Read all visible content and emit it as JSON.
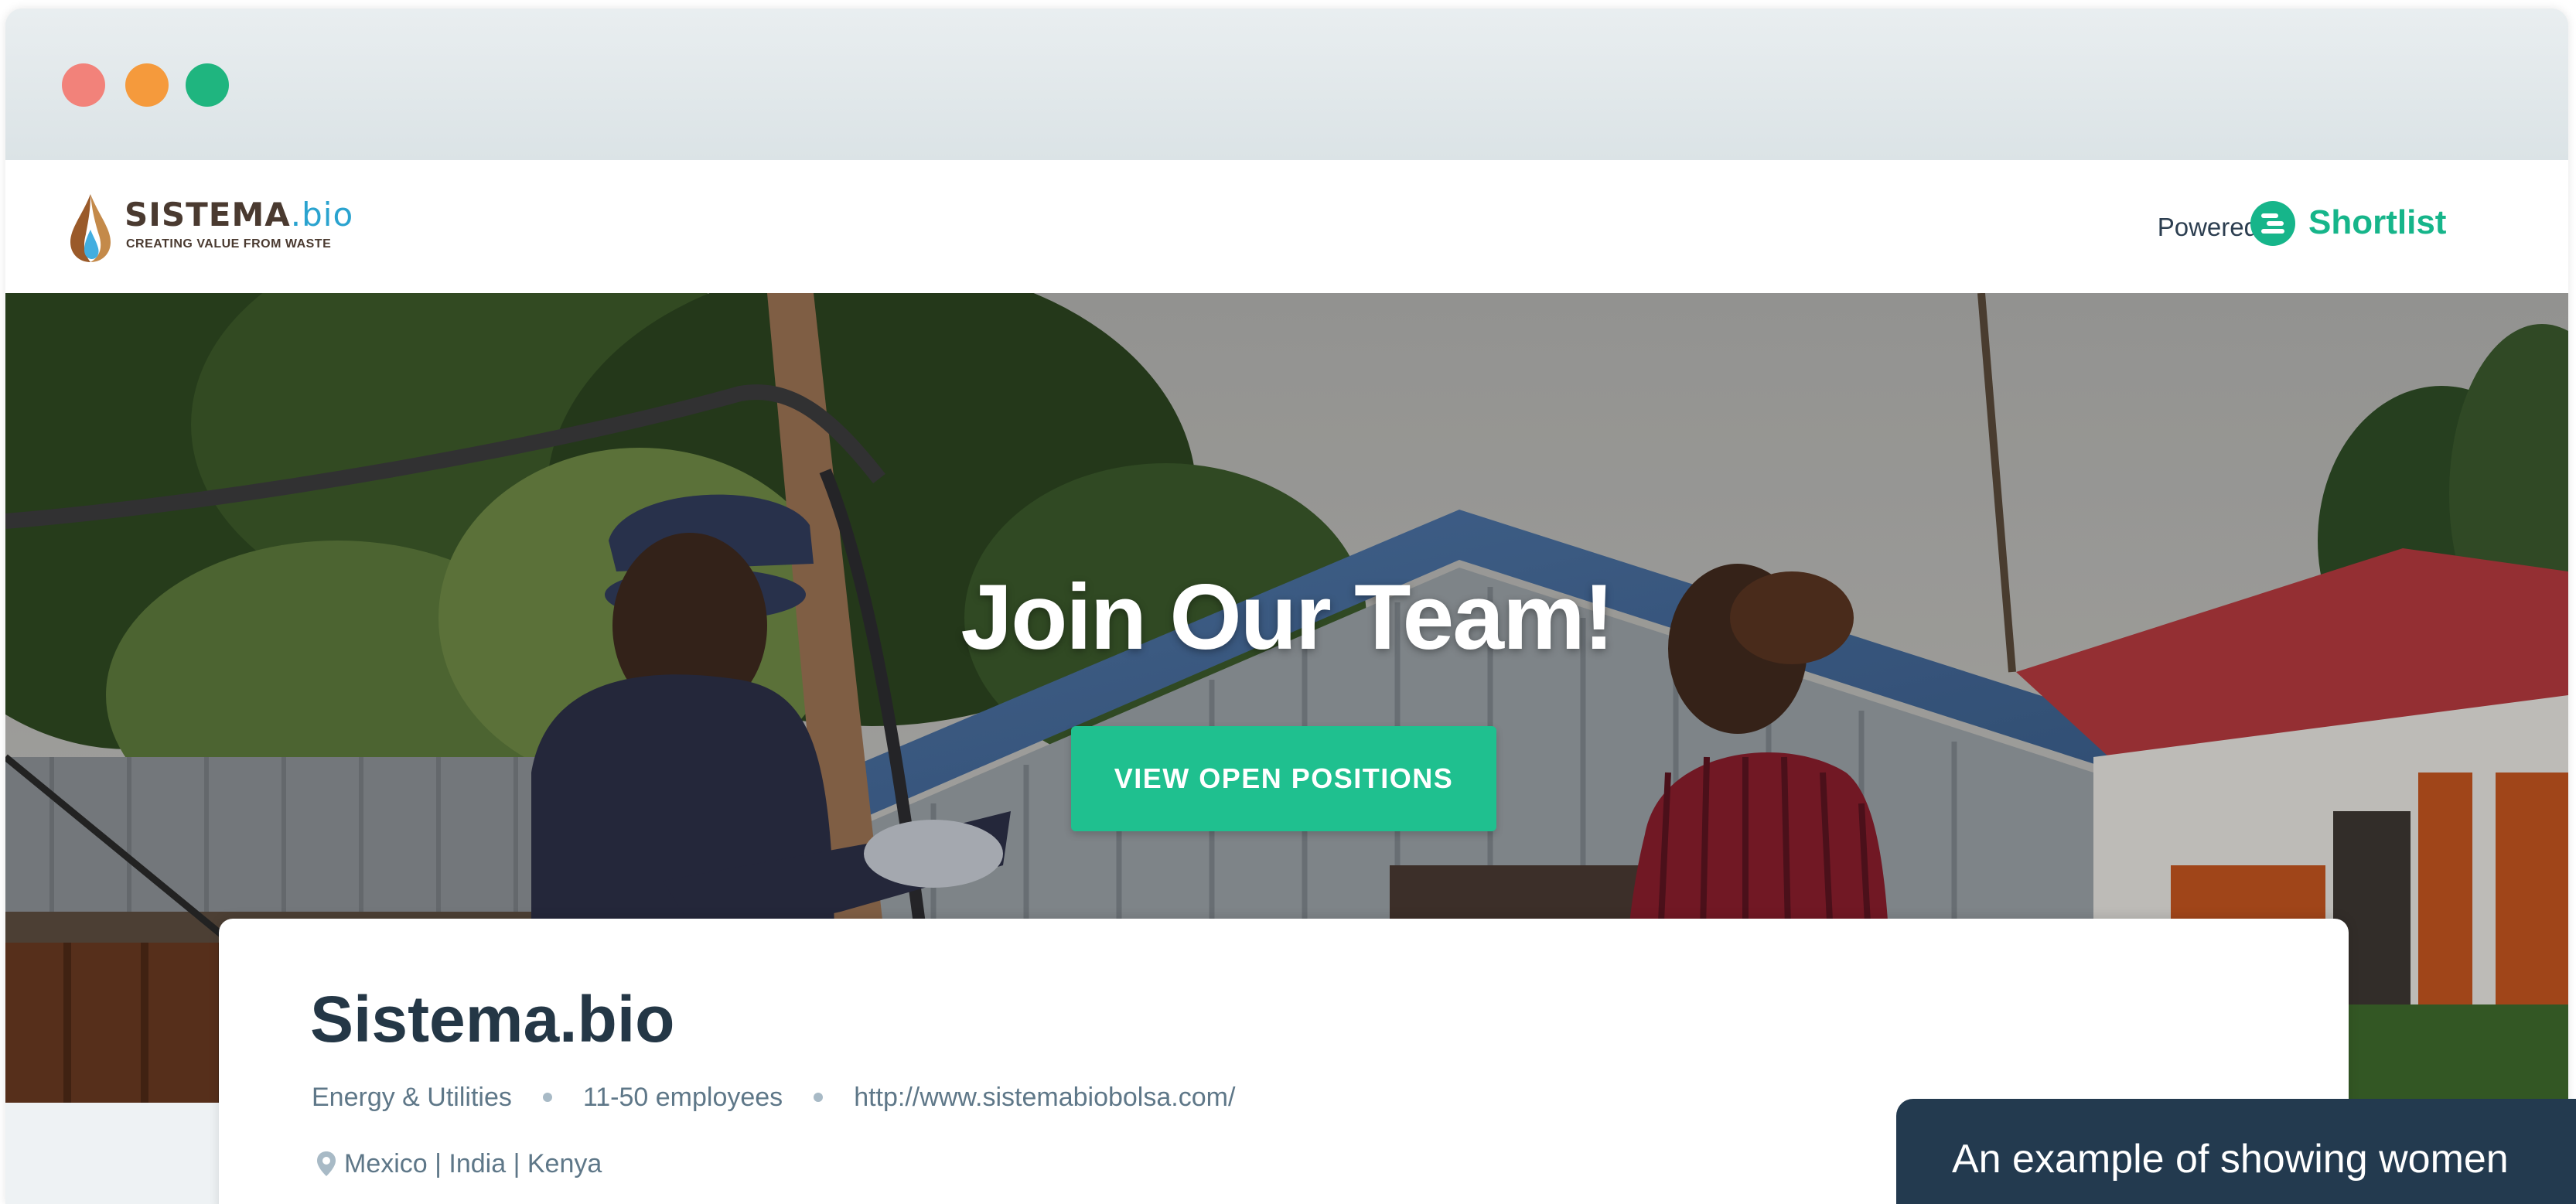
{
  "window": {
    "controls": [
      {
        "name": "close",
        "color": "#f2827a"
      },
      {
        "name": "minimize",
        "color": "#f59a3c"
      },
      {
        "name": "maximize",
        "color": "#1fb57f"
      }
    ]
  },
  "header": {
    "logo": {
      "name_main": "SISTEMA",
      "name_suffix": ".bio",
      "tagline": "CREATING VALUE FROM WASTE",
      "icon": "water-drop-icon"
    },
    "powered_by_label": "Powered by",
    "shortlist": {
      "name": "Shortlist",
      "icon": "shortlist-logo-icon",
      "color": "#16b58a"
    }
  },
  "hero": {
    "title": "Join Our Team!",
    "cta_label": "VIEW OPEN POSITIONS",
    "cta_color": "#1fc08f"
  },
  "company": {
    "name": "Sistema.bio",
    "industry": "Energy & Utilities",
    "size": "11-50 employees",
    "website": "http://www.sistemabiobolsa.com/",
    "locations": "Mexico | India | Kenya",
    "location_icon": "map-pin-icon"
  },
  "caption": {
    "text": "An example of showing women"
  }
}
